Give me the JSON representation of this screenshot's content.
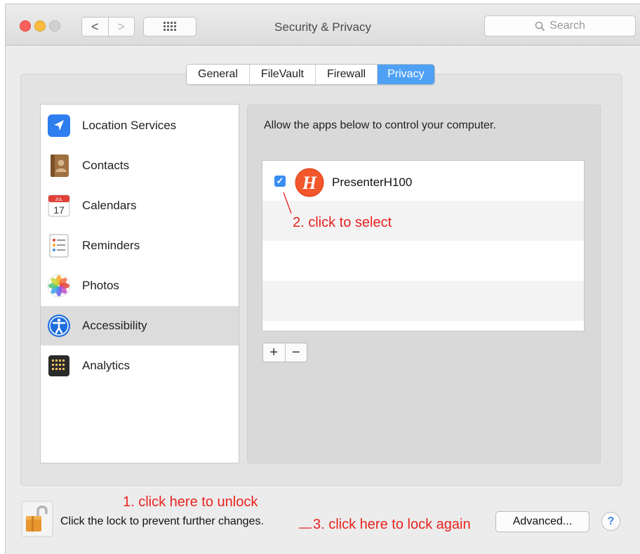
{
  "window": {
    "title": "Security & Privacy",
    "search_placeholder": "Search",
    "nav_back": "<",
    "nav_forward": ">"
  },
  "tabs": [
    {
      "label": "General",
      "selected": false
    },
    {
      "label": "FileVault",
      "selected": false
    },
    {
      "label": "Firewall",
      "selected": false
    },
    {
      "label": "Privacy",
      "selected": true
    }
  ],
  "sidebar": {
    "items": [
      {
        "label": "Location Services",
        "icon": "location-arrow-icon"
      },
      {
        "label": "Contacts",
        "icon": "contacts-book-icon"
      },
      {
        "label": "Calendars",
        "icon": "calendar-icon",
        "icon_text_month": "JUL",
        "icon_text_day": "17"
      },
      {
        "label": "Reminders",
        "icon": "reminders-list-icon"
      },
      {
        "label": "Photos",
        "icon": "photos-flower-icon"
      },
      {
        "label": "Accessibility",
        "icon": "accessibility-person-icon",
        "selected": true
      },
      {
        "label": "Analytics",
        "icon": "analytics-grid-icon"
      }
    ]
  },
  "content": {
    "description": "Allow the apps below to control your computer.",
    "apps": [
      {
        "name": "PresenterH100",
        "checked": true,
        "icon_letter": "H"
      }
    ],
    "add_label": "+",
    "remove_label": "−"
  },
  "annotations": {
    "step1": "1. click here to unlock",
    "step2": "2. click to select",
    "step3": "3. click here to lock again"
  },
  "footer": {
    "lock_text": "Click the lock to prevent further changes.",
    "advanced_label": "Advanced...",
    "help_label": "?"
  },
  "colors": {
    "accent": "#4ea1f5",
    "annotation": "#e8231f",
    "app_icon": "#f2572b"
  }
}
